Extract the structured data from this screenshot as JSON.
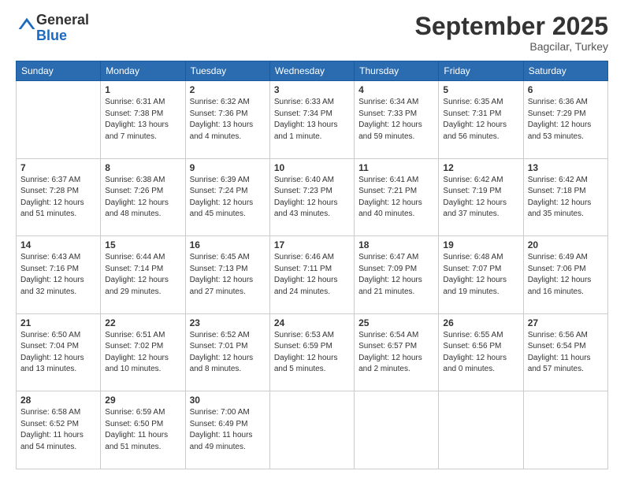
{
  "header": {
    "logo_general": "General",
    "logo_blue": "Blue",
    "month_title": "September 2025",
    "location": "Bagcilar, Turkey"
  },
  "days_of_week": [
    "Sunday",
    "Monday",
    "Tuesday",
    "Wednesday",
    "Thursday",
    "Friday",
    "Saturday"
  ],
  "weeks": [
    [
      {
        "day": "",
        "info": ""
      },
      {
        "day": "1",
        "info": "Sunrise: 6:31 AM\nSunset: 7:38 PM\nDaylight: 13 hours\nand 7 minutes."
      },
      {
        "day": "2",
        "info": "Sunrise: 6:32 AM\nSunset: 7:36 PM\nDaylight: 13 hours\nand 4 minutes."
      },
      {
        "day": "3",
        "info": "Sunrise: 6:33 AM\nSunset: 7:34 PM\nDaylight: 13 hours\nand 1 minute."
      },
      {
        "day": "4",
        "info": "Sunrise: 6:34 AM\nSunset: 7:33 PM\nDaylight: 12 hours\nand 59 minutes."
      },
      {
        "day": "5",
        "info": "Sunrise: 6:35 AM\nSunset: 7:31 PM\nDaylight: 12 hours\nand 56 minutes."
      },
      {
        "day": "6",
        "info": "Sunrise: 6:36 AM\nSunset: 7:29 PM\nDaylight: 12 hours\nand 53 minutes."
      }
    ],
    [
      {
        "day": "7",
        "info": "Sunrise: 6:37 AM\nSunset: 7:28 PM\nDaylight: 12 hours\nand 51 minutes."
      },
      {
        "day": "8",
        "info": "Sunrise: 6:38 AM\nSunset: 7:26 PM\nDaylight: 12 hours\nand 48 minutes."
      },
      {
        "day": "9",
        "info": "Sunrise: 6:39 AM\nSunset: 7:24 PM\nDaylight: 12 hours\nand 45 minutes."
      },
      {
        "day": "10",
        "info": "Sunrise: 6:40 AM\nSunset: 7:23 PM\nDaylight: 12 hours\nand 43 minutes."
      },
      {
        "day": "11",
        "info": "Sunrise: 6:41 AM\nSunset: 7:21 PM\nDaylight: 12 hours\nand 40 minutes."
      },
      {
        "day": "12",
        "info": "Sunrise: 6:42 AM\nSunset: 7:19 PM\nDaylight: 12 hours\nand 37 minutes."
      },
      {
        "day": "13",
        "info": "Sunrise: 6:42 AM\nSunset: 7:18 PM\nDaylight: 12 hours\nand 35 minutes."
      }
    ],
    [
      {
        "day": "14",
        "info": "Sunrise: 6:43 AM\nSunset: 7:16 PM\nDaylight: 12 hours\nand 32 minutes."
      },
      {
        "day": "15",
        "info": "Sunrise: 6:44 AM\nSunset: 7:14 PM\nDaylight: 12 hours\nand 29 minutes."
      },
      {
        "day": "16",
        "info": "Sunrise: 6:45 AM\nSunset: 7:13 PM\nDaylight: 12 hours\nand 27 minutes."
      },
      {
        "day": "17",
        "info": "Sunrise: 6:46 AM\nSunset: 7:11 PM\nDaylight: 12 hours\nand 24 minutes."
      },
      {
        "day": "18",
        "info": "Sunrise: 6:47 AM\nSunset: 7:09 PM\nDaylight: 12 hours\nand 21 minutes."
      },
      {
        "day": "19",
        "info": "Sunrise: 6:48 AM\nSunset: 7:07 PM\nDaylight: 12 hours\nand 19 minutes."
      },
      {
        "day": "20",
        "info": "Sunrise: 6:49 AM\nSunset: 7:06 PM\nDaylight: 12 hours\nand 16 minutes."
      }
    ],
    [
      {
        "day": "21",
        "info": "Sunrise: 6:50 AM\nSunset: 7:04 PM\nDaylight: 12 hours\nand 13 minutes."
      },
      {
        "day": "22",
        "info": "Sunrise: 6:51 AM\nSunset: 7:02 PM\nDaylight: 12 hours\nand 10 minutes."
      },
      {
        "day": "23",
        "info": "Sunrise: 6:52 AM\nSunset: 7:01 PM\nDaylight: 12 hours\nand 8 minutes."
      },
      {
        "day": "24",
        "info": "Sunrise: 6:53 AM\nSunset: 6:59 PM\nDaylight: 12 hours\nand 5 minutes."
      },
      {
        "day": "25",
        "info": "Sunrise: 6:54 AM\nSunset: 6:57 PM\nDaylight: 12 hours\nand 2 minutes."
      },
      {
        "day": "26",
        "info": "Sunrise: 6:55 AM\nSunset: 6:56 PM\nDaylight: 12 hours\nand 0 minutes."
      },
      {
        "day": "27",
        "info": "Sunrise: 6:56 AM\nSunset: 6:54 PM\nDaylight: 11 hours\nand 57 minutes."
      }
    ],
    [
      {
        "day": "28",
        "info": "Sunrise: 6:58 AM\nSunset: 6:52 PM\nDaylight: 11 hours\nand 54 minutes."
      },
      {
        "day": "29",
        "info": "Sunrise: 6:59 AM\nSunset: 6:50 PM\nDaylight: 11 hours\nand 51 minutes."
      },
      {
        "day": "30",
        "info": "Sunrise: 7:00 AM\nSunset: 6:49 PM\nDaylight: 11 hours\nand 49 minutes."
      },
      {
        "day": "",
        "info": ""
      },
      {
        "day": "",
        "info": ""
      },
      {
        "day": "",
        "info": ""
      },
      {
        "day": "",
        "info": ""
      }
    ]
  ]
}
